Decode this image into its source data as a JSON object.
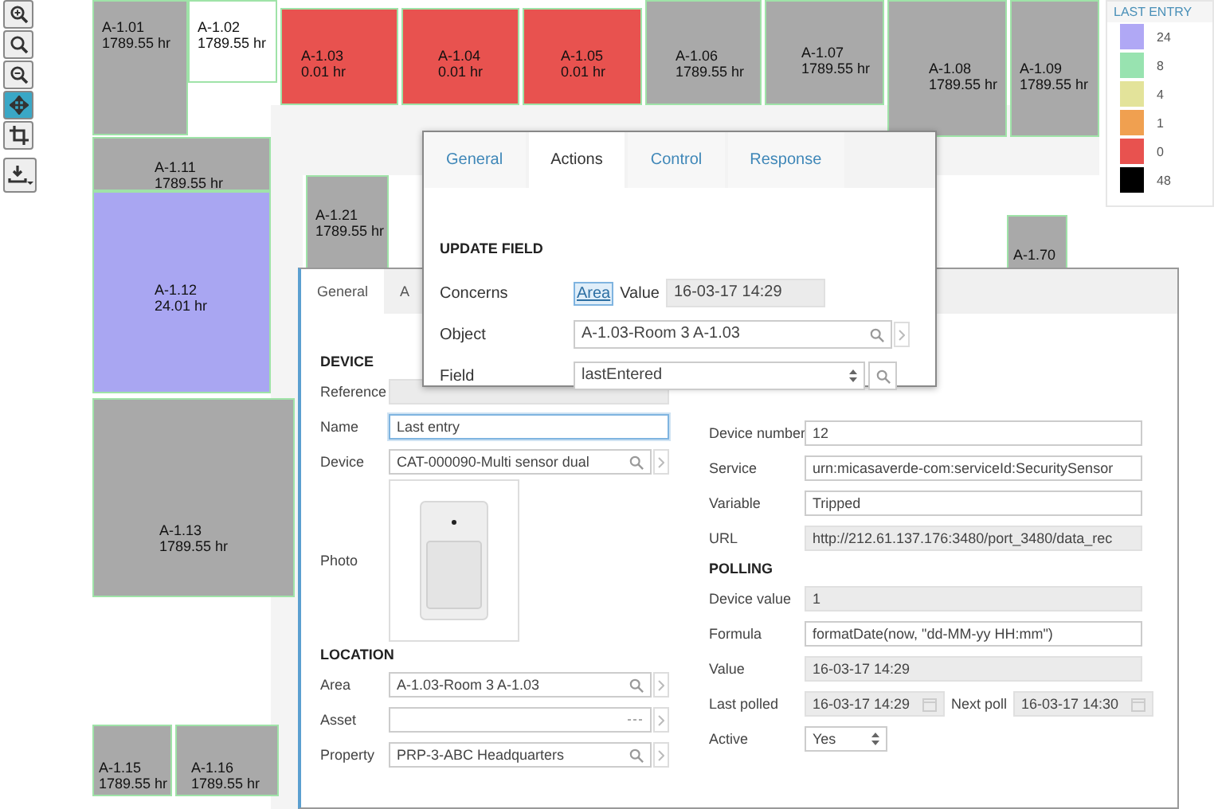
{
  "toolbar": [
    {
      "kind": "zoom-in",
      "selected": false
    },
    {
      "kind": "zoom",
      "selected": false
    },
    {
      "kind": "zoom-out",
      "selected": false
    },
    {
      "kind": "move",
      "selected": true
    },
    {
      "kind": "crop",
      "selected": false
    },
    {
      "kind": "download",
      "selected": false
    }
  ],
  "floor_plan": {
    "rooms": [
      {
        "name": "A-1.01",
        "hours": "1789.55 hr",
        "color": "#a9a9a9"
      },
      {
        "name": "A-1.02",
        "hours": "1789.55 hr",
        "color": "#ffffff"
      },
      {
        "name": "A-1.03",
        "hours": "0.01 hr",
        "color": "#e8524f"
      },
      {
        "name": "A-1.04",
        "hours": "0.01 hr",
        "color": "#e8524f"
      },
      {
        "name": "A-1.05",
        "hours": "0.01 hr",
        "color": "#e8524f"
      },
      {
        "name": "A-1.06",
        "hours": "1789.55 hr",
        "color": "#a9a9a9"
      },
      {
        "name": "A-1.07",
        "hours": "1789.55 hr",
        "color": "#a9a9a9"
      },
      {
        "name": "A-1.08",
        "hours": "1789.55 hr",
        "color": "#a9a9a9"
      },
      {
        "name": "A-1.09",
        "hours": "1789.55 hr",
        "color": "#a9a9a9"
      },
      {
        "name": "A-1.11",
        "hours": "1789.55 hr",
        "color": "#a9a9a9"
      },
      {
        "name": "A-1.12",
        "hours": "24.01 hr",
        "color": "#a9a6f2"
      },
      {
        "name": "A-1.21",
        "hours": "1789.55 hr",
        "color": "#a9a9a9"
      },
      {
        "name": "A-1.70",
        "color": "#a9a9a9"
      },
      {
        "name": "A-1.13",
        "hours": "1789.55 hr",
        "color": "#a9a9a9"
      },
      {
        "name": "A-1.15",
        "hours": "1789.55 hr",
        "color": "#a9a9a9"
      },
      {
        "name": "A-1.16",
        "hours": "1789.55 hr",
        "color": "#a9a9a9"
      }
    ]
  },
  "legend": {
    "title": "LAST ENTRY",
    "items": [
      {
        "label": "24",
        "color": "#b0a8f5"
      },
      {
        "label": "8",
        "color": "#98e3b0"
      },
      {
        "label": "4",
        "color": "#e3e39a"
      },
      {
        "label": "1",
        "color": "#f0a050"
      },
      {
        "label": "0",
        "color": "#e8524f"
      },
      {
        "label": "48",
        "color": "#000000"
      }
    ]
  },
  "device_dialog": {
    "tabs": [
      {
        "label": "General",
        "selected": true
      },
      {
        "label": "A",
        "selected": false
      }
    ],
    "columns": [
      {
        "rows": [
          {
            "kind": "heading",
            "label": "DEVICE"
          },
          {
            "kind": "readonly",
            "label": "Reference"
          },
          {
            "kind": "text",
            "label": "Name",
            "value": "Last entry",
            "focused": true
          },
          {
            "kind": "search",
            "label": "Device",
            "value": "CAT-000090-Multi sensor dual"
          },
          {
            "kind": "photo",
            "label": "Photo"
          },
          {
            "kind": "heading",
            "label": "LOCATION"
          },
          {
            "kind": "search",
            "label": "Area",
            "value": "A-1.03-Room 3 A-1.03"
          },
          {
            "kind": "more",
            "label": "Asset"
          },
          {
            "kind": "search",
            "label": "Property",
            "value": "PRP-3-ABC Headquarters"
          }
        ]
      },
      {
        "rows": [
          {
            "kind": "text",
            "label": "Device number",
            "value": "12"
          },
          {
            "kind": "text",
            "label": "Service",
            "value": "urn:micasaverde-com:serviceId:SecuritySensor"
          },
          {
            "kind": "text",
            "label": "Variable",
            "value": "Tripped"
          },
          {
            "kind": "readonly",
            "label": "URL",
            "value": "http://212.61.137.176:3480/port_3480/data_rec"
          },
          {
            "kind": "heading",
            "label": "POLLING"
          },
          {
            "kind": "readonly",
            "label": "Device value",
            "value": "1"
          },
          {
            "kind": "text",
            "label": "Formula",
            "value": "formatDate(now, \"dd-MM-yy HH:mm\")"
          },
          {
            "kind": "readonly",
            "label": "Value",
            "value": "16-03-17 14:29"
          },
          {
            "kind": "date-pair",
            "label": "Last polled",
            "value": "16-03-17 14:29",
            "second_label": "Next poll",
            "second_value": "16-03-17 14:30"
          },
          {
            "kind": "select",
            "label": "Active",
            "value": "Yes"
          }
        ]
      }
    ]
  },
  "action_dialog": {
    "tabs": [
      {
        "label": "General",
        "selected": false
      },
      {
        "label": "Actions",
        "selected": true
      },
      {
        "label": "Control",
        "selected": false
      },
      {
        "label": "Response",
        "selected": false
      }
    ],
    "heading": "UPDATE FIELD",
    "concerns": {
      "label": "Concerns",
      "toggle": "Area",
      "selected": true,
      "value_label": "Value",
      "value": "16-03-17 14:29"
    },
    "object": {
      "label": "Object",
      "value": "A-1.03-Room 3 A-1.03"
    },
    "field": {
      "label": "Field",
      "value": "lastEntered"
    }
  }
}
